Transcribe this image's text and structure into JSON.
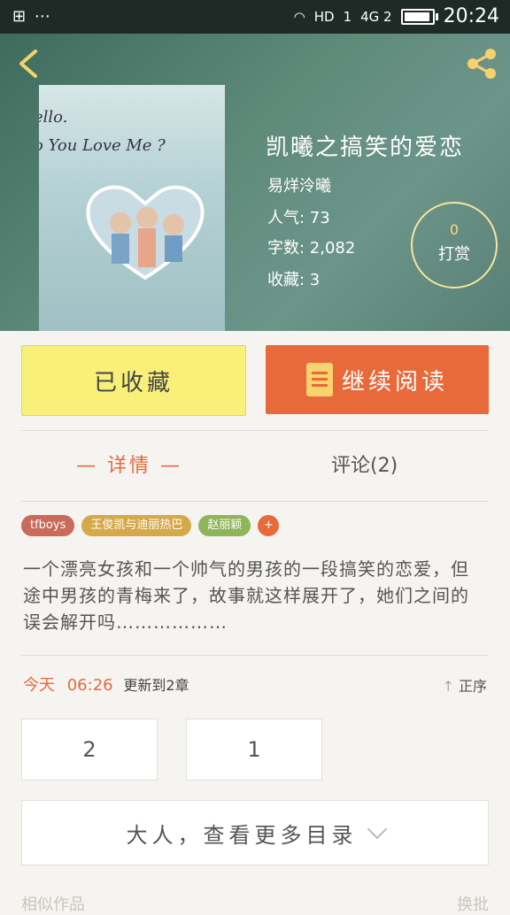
{
  "status_bar": {
    "left": "⊞ ⋯",
    "network": "HD",
    "signal1": "1",
    "signal2": "4G 2",
    "time": "20:24"
  },
  "book": {
    "cover_text_line1": "ello.",
    "cover_text_line2": "o You Love Me ?",
    "title": "凯曦之搞笑的爱恋",
    "author": "易烊泠曦",
    "popularity": "人气: 73",
    "word_count": "字数: 2,082",
    "favorites": "收藏: 3",
    "reward_count": "0",
    "reward_label": "打赏"
  },
  "actions": {
    "collected_label": "已收藏",
    "continue_label": "继续阅读"
  },
  "tabs": {
    "detail": "— 详情 —",
    "comments": "评论(2)"
  },
  "tags": [
    {
      "label": "tfboys",
      "color": "#c96a5a"
    },
    {
      "label": "王俊凯与迪丽热巴",
      "color": "#d5a84a"
    },
    {
      "label": "赵丽颖",
      "color": "#8fb45a"
    }
  ],
  "tag_add": "+",
  "description": "一个漂亮女孩和一个帅气的男孩的一段搞笑的恋爱，但途中男孩的青梅来了，故事就这样展开了，她们之间的误会解开吗………………",
  "update": {
    "day": "今天",
    "time": "06:26",
    "note": "更新到2章",
    "sort": "正序"
  },
  "chapters": [
    "2",
    "1"
  ],
  "more_catalog": "大人，查看更多目录",
  "footer": {
    "left": "相似作品",
    "right": "换批"
  },
  "colors": {
    "accent": "#e8693a",
    "collected_bg": "#f9f07a",
    "hero_bg": "#5f8b7b"
  }
}
